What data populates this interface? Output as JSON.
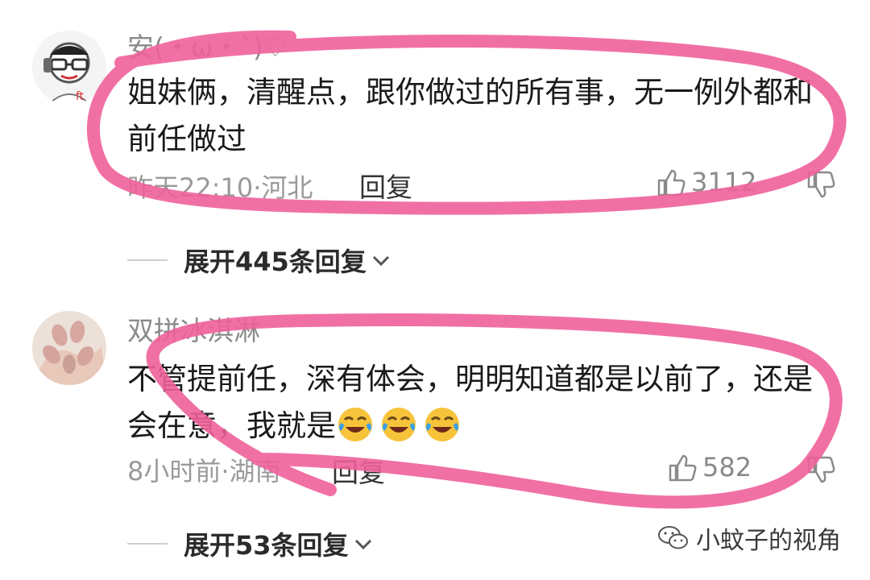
{
  "comments": [
    {
      "username": "安(・ω・`)♡",
      "text": "姐妹俩，清醒点，跟你做过的所有事，无一例外都和前任做过",
      "time_location": "昨天22:10·河北",
      "reply_label": "回复",
      "likes": "3112",
      "expand_label": "展开445条回复"
    },
    {
      "username": "双拼冰淇淋",
      "text": "不管提前任，深有体会，明明知道都是以前了，还是会在意，我就是",
      "emoji_count": 3,
      "time_location": "8小时前·湖南",
      "reply_label": "回复",
      "likes": "582",
      "expand_label": "展开53条回复"
    }
  ],
  "watermark": "小蚊子的视角",
  "colors": {
    "annotation": "#f0609a",
    "meta": "#9a9a9a",
    "text": "#1a1a1a"
  }
}
